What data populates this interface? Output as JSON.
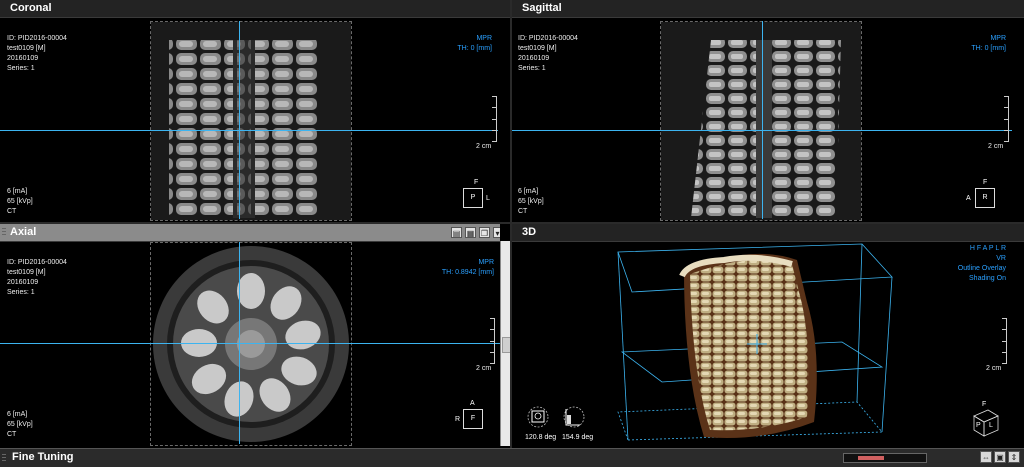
{
  "colors": {
    "accent": "#2aa0ff",
    "crosshair": "#3cb4f0",
    "active_header": "#8b8b8b"
  },
  "panes": {
    "coronal": {
      "title": "Coronal",
      "info": [
        "ID: PID2016-00004",
        "test0109 [M]",
        "20160109",
        "Series: 1"
      ],
      "info_bottom": [
        "6 [mA]",
        "65 [kVp]",
        "CT"
      ],
      "mode": "MPR",
      "thickness": "TH: 0 [mm]",
      "scale": "2 cm",
      "orient_top": "F",
      "orient_box": "P",
      "orient_right": "L"
    },
    "sagittal": {
      "title": "Sagittal",
      "info": [
        "ID: PID2016-00004",
        "test0109 [M]",
        "20160109",
        "Series: 1"
      ],
      "info_bottom": [
        "6 [mA]",
        "65 [kVp]",
        "CT"
      ],
      "mode": "MPR",
      "thickness": "TH: 0 [mm]",
      "scale": "2 cm",
      "orient_top": "F",
      "orient_box": "R",
      "orient_left": "A"
    },
    "axial": {
      "title": "Axial",
      "info": [
        "ID: PID2016-00004",
        "test0109 [M]",
        "20160109",
        "Series: 1"
      ],
      "info_bottom": [
        "6 [mA]",
        "65 [kVp]",
        "CT"
      ],
      "mode": "MPR",
      "thickness": "TH: 0.8942 [mm]",
      "scale": "2 cm",
      "orient_top": "A",
      "orient_box": "F",
      "orient_left": "R",
      "toolbar_icons": [
        "layout-icon",
        "grid-icon",
        "copy-icon",
        "dropdown-icon"
      ]
    },
    "three_d": {
      "title": "3D",
      "orientation_letters": "H F A P L R",
      "mode": "VR",
      "overlay": "Outline Overlay",
      "shading": "Shading On",
      "scale": "2 cm",
      "angle1": "120.8 deg",
      "angle2": "154.9 deg",
      "cube_labels": {
        "top": "F",
        "left": "P",
        "right": "L"
      }
    }
  },
  "bottom_bar": {
    "title": "Fine Tuning",
    "buttons": [
      "expand-icon",
      "split-icon",
      "collapse-icon"
    ]
  }
}
